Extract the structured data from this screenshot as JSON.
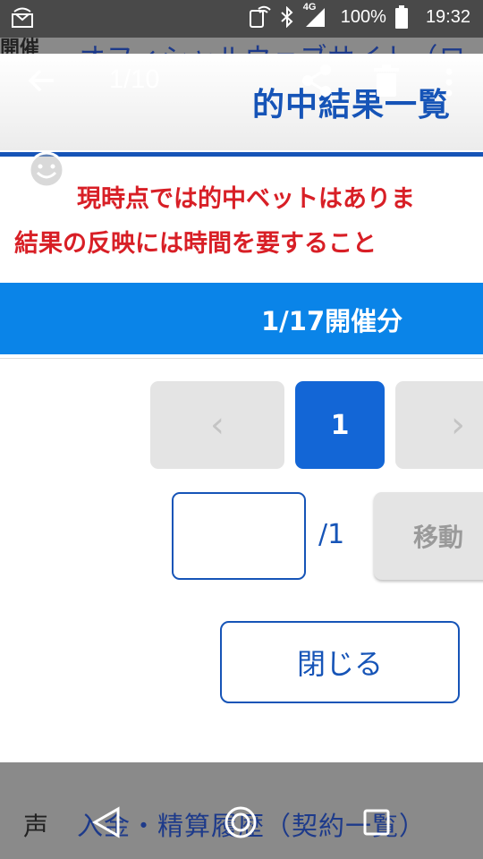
{
  "status_bar": {
    "battery_text": "100%",
    "time": "19:32",
    "network": "4G"
  },
  "background_page": {
    "top_left_text": "開催",
    "top_text": "オフィシャルウェブサイト（ロ",
    "bottom_left_text": "声",
    "bottom_text": "入金・精算履歴（契約一覧）"
  },
  "viewer": {
    "counter": "1/10"
  },
  "screenshot": {
    "title": "的中結果一覧",
    "notice_line1": "現時点では的中ベットはありま",
    "notice_line2": "結果の反映には時間を要すること",
    "date_label": "1/17開催分",
    "pagination": {
      "prev_symbol": "‹",
      "current_page": "1",
      "next_symbol": "›"
    },
    "page_input_value": "",
    "page_total": "/1",
    "move_button": "移動",
    "close_button": "閉じる"
  },
  "colors": {
    "brand_blue": "#1654b7",
    "notice_red": "#d81f26",
    "date_bar_blue": "#0a84e8",
    "active_page_blue": "#1366d6"
  },
  "icons": {
    "viewer": [
      "back-arrow-icon",
      "share-icon",
      "delete-icon",
      "more-vert-icon"
    ],
    "status": [
      "cast-icon",
      "nfc-icon",
      "bluetooth-icon",
      "signal-icon",
      "battery-icon"
    ],
    "nav": [
      "nav-back-icon",
      "nav-home-icon",
      "nav-recent-icon"
    ]
  }
}
